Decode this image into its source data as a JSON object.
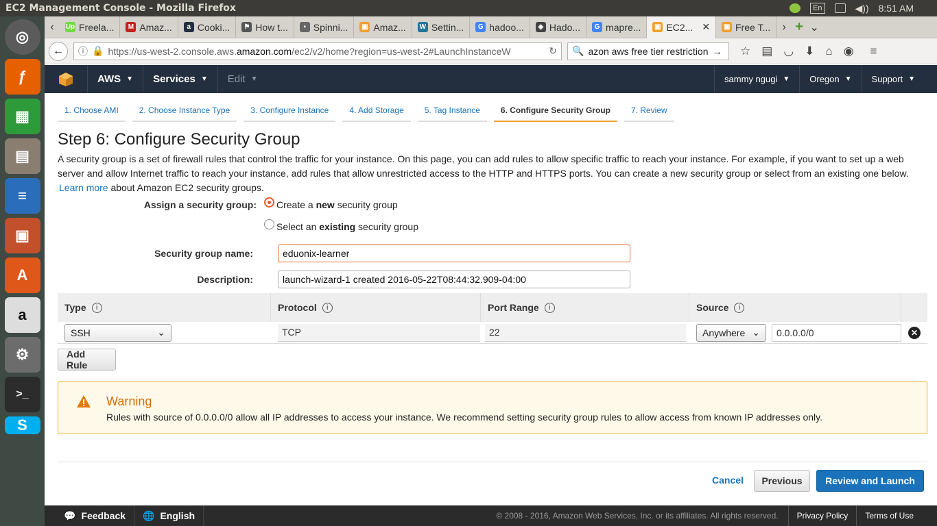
{
  "os": {
    "window_title": "EC2 Management Console - Mozilla Firefox",
    "tray": {
      "lang": "En",
      "time": "8:51 AM"
    }
  },
  "browser": {
    "tabs": [
      {
        "label": "Freela...",
        "fav": "Up",
        "color": "#6fda44"
      },
      {
        "label": "Amaz...",
        "fav": "M",
        "color": "#c5221f"
      },
      {
        "label": "Cooki...",
        "fav": "a",
        "color": "#232f3e"
      },
      {
        "label": "How t...",
        "fav": "⚑",
        "color": "#555"
      },
      {
        "label": "Spinni...",
        "fav": "▪",
        "color": "#666"
      },
      {
        "label": "Amaz...",
        "fav": "▣",
        "color": "#f0a030"
      },
      {
        "label": "Settin...",
        "fav": "W",
        "color": "#21759b"
      },
      {
        "label": "hadoo...",
        "fav": "G",
        "color": "#4285f4"
      },
      {
        "label": "Hado...",
        "fav": "◈",
        "color": "#444"
      },
      {
        "label": "mapre...",
        "fav": "G",
        "color": "#4285f4"
      },
      {
        "label": "EC2...",
        "fav": "▣",
        "color": "#f0a030",
        "active": true
      },
      {
        "label": "Free T...",
        "fav": "▣",
        "color": "#f0a030"
      }
    ],
    "url_prefix": "https://us-west-2.console.aws.",
    "url_domain": "amazon.com",
    "url_rest": "/ec2/v2/home?region=us-west-2#LaunchInstanceW",
    "search_text": "azon aws free tier restriction"
  },
  "aws_nav": {
    "aws": "AWS",
    "services": "Services",
    "edit": "Edit",
    "user": "sammy ngugi",
    "region": "Oregon",
    "support": "Support"
  },
  "wizard_steps": [
    "1. Choose AMI",
    "2. Choose Instance Type",
    "3. Configure Instance",
    "4. Add Storage",
    "5. Tag Instance",
    "6. Configure Security Group",
    "7. Review"
  ],
  "page": {
    "title": "Step 6: Configure Security Group",
    "intro": "A security group is a set of firewall rules that control the traffic for your instance. On this page, you can add rules to allow specific traffic to reach your instance. For example, if you want to set up a web server and allow Internet traffic to reach your instance, add rules that allow unrestricted access to the HTTP and HTTPS ports. You can create a new security group or select from an existing one below.",
    "learn_more": "Learn more",
    "learn_more_suffix": "about Amazon EC2 security groups."
  },
  "form": {
    "assign_label": "Assign a security group:",
    "option_new_pre": "Create a ",
    "option_new_bold": "new",
    "option_new_post": " security group",
    "option_existing_pre": "Select an ",
    "option_existing_bold": "existing",
    "option_existing_post": " security group",
    "name_label": "Security group name:",
    "name_value": "eduonix-learner",
    "desc_label": "Description:",
    "desc_value": "launch-wizard-1 created 2016-05-22T08:44:32.909-04:00"
  },
  "rules_table": {
    "headers": [
      "Type",
      "Protocol",
      "Port Range",
      "Source"
    ],
    "rows": [
      {
        "type": "SSH",
        "protocol": "TCP",
        "port": "22",
        "source_select": "Anywhere",
        "source_cidr": "0.0.0.0/0"
      }
    ],
    "add_rule": "Add Rule"
  },
  "warning": {
    "title": "Warning",
    "message": "Rules with source of 0.0.0.0/0 allow all IP addresses to access your instance. We recommend setting security group rules to allow access from known IP addresses only."
  },
  "actions": {
    "cancel": "Cancel",
    "previous": "Previous",
    "review": "Review and Launch"
  },
  "footer": {
    "feedback": "Feedback",
    "language": "English",
    "copyright": "© 2008 - 2016, Amazon Web Services, Inc. or its affiliates. All rights reserved.",
    "privacy": "Privacy Policy",
    "terms": "Terms of Use"
  }
}
